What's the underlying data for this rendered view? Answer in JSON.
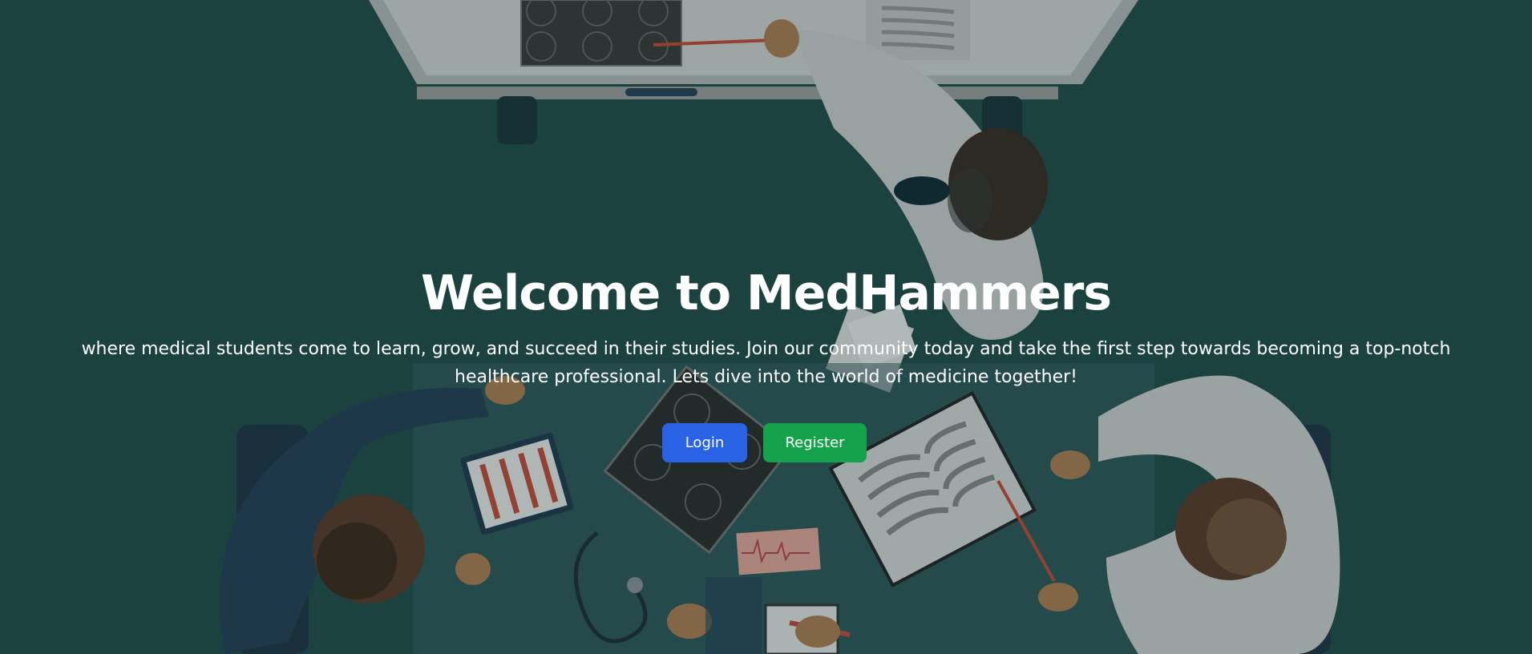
{
  "hero": {
    "title": "Welcome to MedHammers",
    "subtitle": "where medical students come to learn, grow, and succeed in their studies. Join our community today and take the first step towards becoming a top-notch healthcare professional. Lets dive into the world of medicine together!",
    "buttons": {
      "login_label": "Login",
      "register_label": "Register"
    },
    "background_illustration": "doctors-meeting-overhead-illustration"
  },
  "colors": {
    "background": "#1f4a45",
    "login_button": "#2a62e6",
    "register_button": "#14a24a",
    "text": "#ffffff"
  }
}
